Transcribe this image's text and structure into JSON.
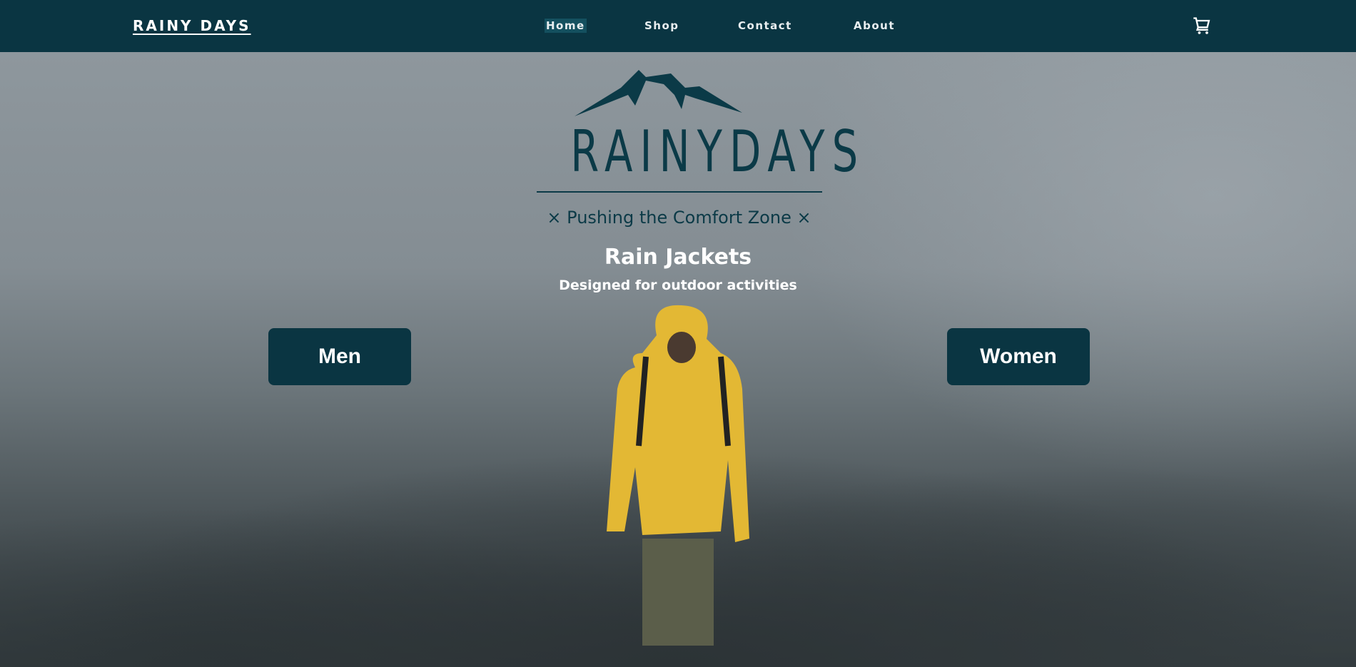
{
  "nav": {
    "brand": "RAINY DAYS",
    "links": [
      {
        "label": "Home",
        "active": true
      },
      {
        "label": "Shop"
      },
      {
        "label": "Contact"
      },
      {
        "label": "About"
      }
    ],
    "cart_icon": "shopping-cart-icon"
  },
  "hero": {
    "logo": {
      "wordmark": "RAINYDAYS",
      "tagline": "× Pushing the Comfort Zone ×"
    },
    "title": "Rain Jackets",
    "subtitle": "Designed for outdoor activities",
    "buttons": {
      "men": "Men",
      "women": "Women"
    }
  },
  "colors": {
    "primary": "#0a3542",
    "active_link_bg": "#14505f",
    "jacket": "#e3b834"
  }
}
